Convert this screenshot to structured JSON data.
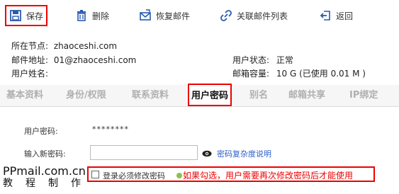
{
  "toolbar": {
    "save_label": "保存",
    "delete_label": "删除",
    "restore_label": "恢复邮件",
    "linked_label": "关联邮件列表",
    "back_label": "返回"
  },
  "info": {
    "node_label": "所在节点:",
    "node_value": "zhaoceshi.com",
    "address_label": "邮件地址:",
    "address_value": "01@zhaoceshi.com",
    "name_label": "用户姓名:",
    "status_label": "用户状态:",
    "status_value": "正常",
    "capacity_label": "邮箱容量:",
    "capacity_value": "10 G (已使用 0.01 M )"
  },
  "tabs": [
    {
      "label": "基本资料",
      "active": false
    },
    {
      "label": "身份/权限",
      "active": false
    },
    {
      "label": "联系资料",
      "active": false
    },
    {
      "label": "用户密码",
      "active": true
    },
    {
      "label": "别名",
      "active": false
    },
    {
      "label": "邮箱共享",
      "active": false
    },
    {
      "label": "IP绑定",
      "active": false
    }
  ],
  "form": {
    "current_password_label": "用户密码:",
    "current_password_value": "********",
    "new_password_label": "输入新密码:",
    "new_password_value": "",
    "complexity_link": "密码复杂度说明",
    "force_change_label": "登录必须修改密码",
    "force_change_checked": false,
    "note": "如果勾选，用户需要再次修改密码后才能使用"
  },
  "watermark": {
    "line1": "PPmail.com.cn",
    "line2": "教程制作"
  },
  "colors": {
    "highlight": "#e00000",
    "link": "#2b60c8",
    "tab_inactive": "#b0b0b0"
  }
}
